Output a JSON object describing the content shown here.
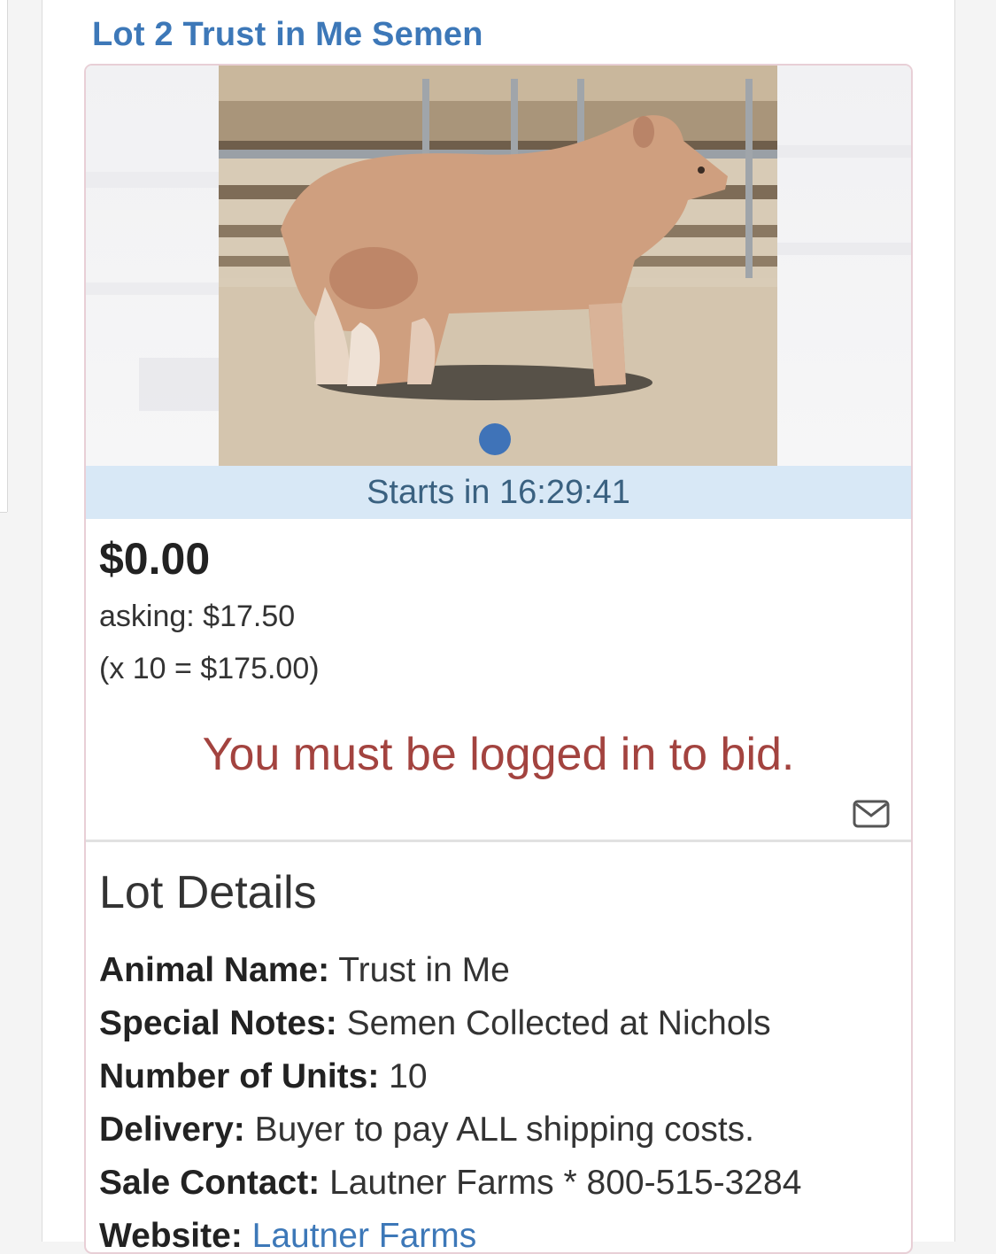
{
  "lot": {
    "title": "Lot 2 Trust in Me Semen",
    "timer": "Starts in 16:29:41",
    "price": "$0.00",
    "asking": "asking: $17.50",
    "multiplier": "(x 10 = $175.00)",
    "login_message": "You must be logged in to bid."
  },
  "icons": {
    "mail": "mail-icon",
    "carousel_dot": "carousel-dot"
  },
  "details": {
    "title": "Lot Details",
    "rows": [
      {
        "label": "Animal Name:",
        "value": "Trust in Me"
      },
      {
        "label": "Special Notes:",
        "value": "Semen Collected at Nichols"
      },
      {
        "label": "Number of Units:",
        "value": "10"
      },
      {
        "label": "Delivery:",
        "value": "Buyer to pay ALL shipping costs."
      },
      {
        "label": "Sale Contact:",
        "value": "Lautner Farms * 800-515-3284"
      },
      {
        "label": "Website:",
        "value": "Lautner Farms"
      }
    ]
  },
  "colors": {
    "accent": "#3d78b8",
    "error": "#a3433f",
    "timer_bg": "#d8e8f6",
    "card_border": "#e8cfd6"
  }
}
